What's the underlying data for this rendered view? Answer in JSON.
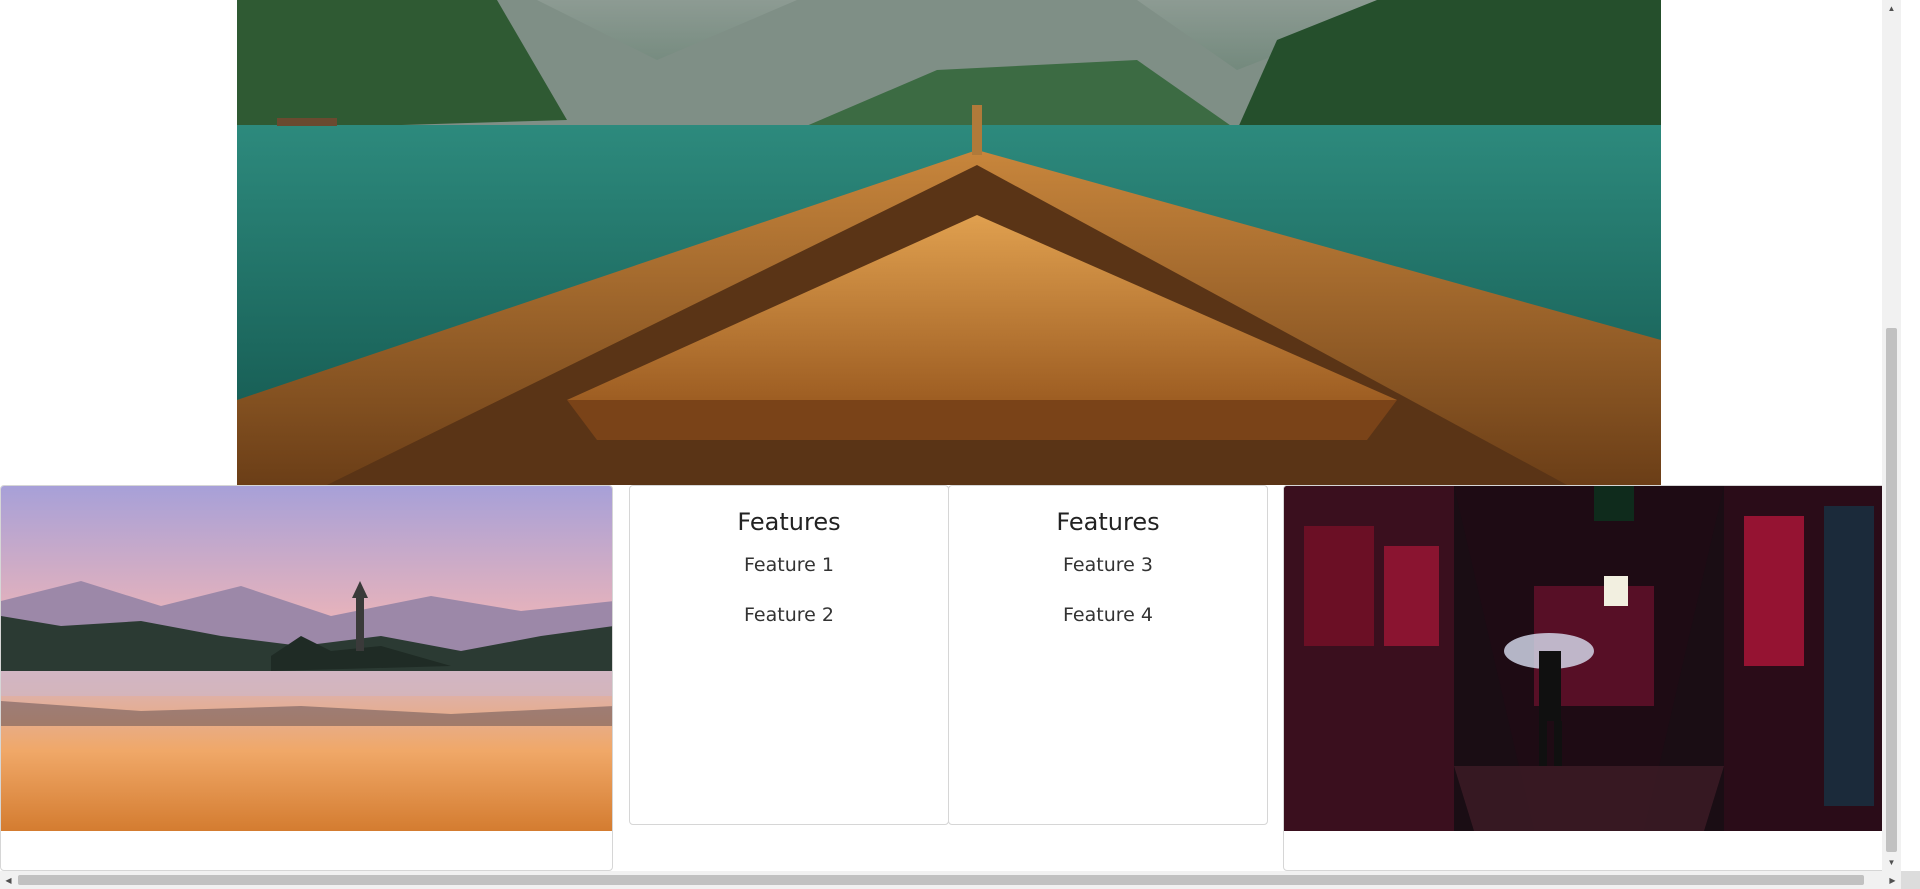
{
  "cards": [
    {
      "type": "image",
      "alt": ""
    },
    {
      "type": "features",
      "title": "Features",
      "items": [
        "Feature 1",
        "Feature 2"
      ]
    },
    {
      "type": "features",
      "title": "Features",
      "items": [
        "Feature 3",
        "Feature 4"
      ]
    },
    {
      "type": "image",
      "alt": ""
    }
  ],
  "scrollbars": {
    "vertical": {
      "up_icon": "triangle-up",
      "down_icon": "triangle-down"
    },
    "horizontal": {
      "left_icon": "triangle-left",
      "right_icon": "triangle-right"
    }
  },
  "colors": {
    "card_border": "#d6d6d6",
    "scrollbar_track": "#f1f1f1",
    "scrollbar_thumb": "#c1c1c1"
  }
}
